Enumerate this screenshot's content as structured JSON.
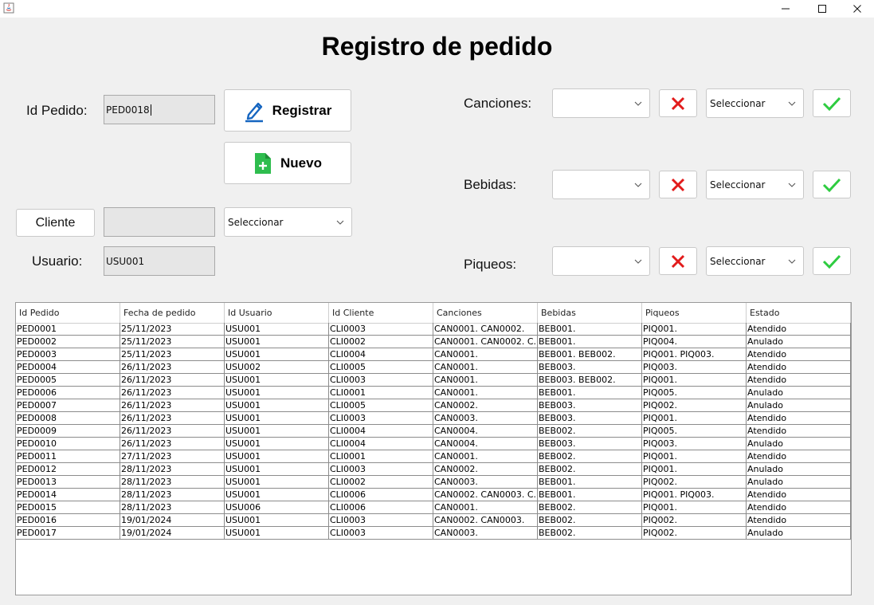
{
  "window": {
    "minimize_glyph": "—",
    "maximize_glyph": "☐",
    "close_glyph": "✕"
  },
  "title": "Registro de pedido",
  "form": {
    "id_pedido_label": "Id Pedido:",
    "id_pedido_value": "PED0018",
    "registrar_label": "Registrar",
    "nuevo_label": "Nuevo",
    "cliente_button_label": "Cliente",
    "cliente_value": "",
    "cliente_combo_value": "Seleccionar",
    "usuario_label": "Usuario:",
    "usuario_value": "USU001"
  },
  "products": {
    "canciones_label": "Canciones:",
    "canciones_combo_value": "",
    "canciones_select_value": "Seleccionar",
    "bebidas_label": "Bebidas:",
    "bebidas_combo_value": "",
    "bebidas_select_value": "Seleccionar",
    "piqueos_label": "Piqueos:",
    "piqueos_combo_value": "",
    "piqueos_select_value": "Seleccionar"
  },
  "colors": {
    "remove_icon": "#e21b1b",
    "confirm_icon": "#2ecc40",
    "edit_icon": "#1565c0",
    "new_icon": "#2ebd4e"
  },
  "table": {
    "headers": [
      "Id Pedido",
      "Fecha de pedido",
      "Id Usuario",
      "Id Cliente",
      "Canciones",
      "Bebidas",
      "Piqueos",
      "Estado"
    ],
    "rows": [
      [
        "PED0001",
        "25/11/2023",
        "USU001",
        "CLI0003",
        "CAN0001. CAN0002.",
        "BEB001.",
        "PIQ001.",
        "Atendido"
      ],
      [
        "PED0002",
        "25/11/2023",
        "USU001",
        "CLI0002",
        "CAN0001. CAN0002. C...",
        "BEB001.",
        "PIQ004.",
        "Anulado"
      ],
      [
        "PED0003",
        "25/11/2023",
        "USU001",
        "CLI0004",
        "CAN0001.",
        "BEB001. BEB002.",
        "PIQ001. PIQ003.",
        "Atendido"
      ],
      [
        "PED0004",
        "26/11/2023",
        "USU002",
        "CLI0005",
        "CAN0001.",
        "BEB003.",
        "PIQ003.",
        "Atendido"
      ],
      [
        "PED0005",
        "26/11/2023",
        "USU001",
        "CLI0003",
        "CAN0001.",
        "BEB003. BEB002.",
        "PIQ001.",
        "Atendido"
      ],
      [
        "PED0006",
        "26/11/2023",
        "USU001",
        "CLI0001",
        "CAN0001.",
        "BEB001.",
        "PIQ005.",
        "Anulado"
      ],
      [
        "PED0007",
        "26/11/2023",
        "USU001",
        "CLI0005",
        "CAN0002.",
        "BEB003.",
        "PIQ002.",
        "Anulado"
      ],
      [
        "PED0008",
        "26/11/2023",
        "USU001",
        "CLI0003",
        "CAN0003.",
        "BEB003.",
        "PIQ001.",
        "Atendido"
      ],
      [
        "PED0009",
        "26/11/2023",
        "USU001",
        "CLI0004",
        "CAN0004.",
        "BEB002.",
        "PIQ005.",
        "Atendido"
      ],
      [
        "PED0010",
        "26/11/2023",
        "USU001",
        "CLI0004",
        "CAN0004.",
        "BEB003.",
        "PIQ003.",
        "Anulado"
      ],
      [
        "PED0011",
        "27/11/2023",
        "USU001",
        "CLI0001",
        "CAN0001.",
        "BEB002.",
        "PIQ001.",
        "Atendido"
      ],
      [
        "PED0012",
        "28/11/2023",
        "USU001",
        "CLI0003",
        "CAN0002.",
        "BEB002.",
        "PIQ001.",
        "Anulado"
      ],
      [
        "PED0013",
        "28/11/2023",
        "USU001",
        "CLI0002",
        "CAN0003.",
        "BEB001.",
        "PIQ002.",
        "Anulado"
      ],
      [
        "PED0014",
        "28/11/2023",
        "USU001",
        "CLI0006",
        "CAN0002. CAN0003. C...",
        "BEB001.",
        "PIQ001. PIQ003.",
        "Atendido"
      ],
      [
        "PED0015",
        "28/11/2023",
        "USU006",
        "CLI0006",
        "CAN0001.",
        "BEB002.",
        "PIQ001.",
        "Atendido"
      ],
      [
        "PED0016",
        "19/01/2024",
        "USU001",
        "CLI0003",
        "CAN0002. CAN0003.",
        "BEB002.",
        "PIQ002.",
        "Atendido"
      ],
      [
        "PED0017",
        "19/01/2024",
        "USU001",
        "CLI0003",
        "CAN0003.",
        "BEB002.",
        "PIQ002.",
        "Anulado"
      ]
    ]
  }
}
